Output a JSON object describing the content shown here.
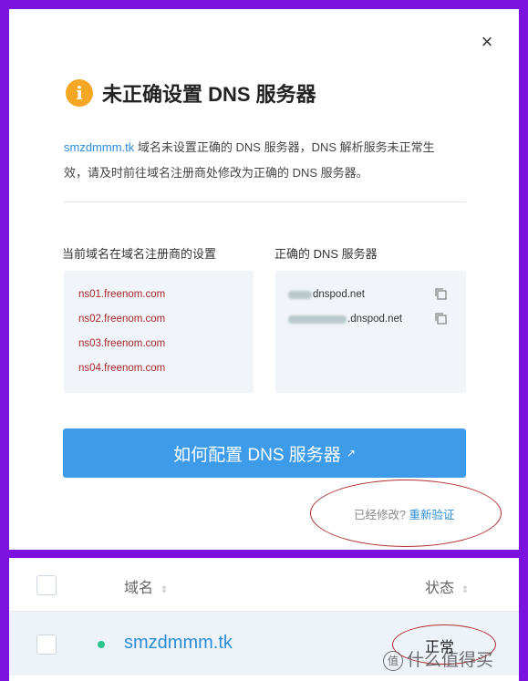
{
  "dialog": {
    "title": "未正确设置 DNS 服务器",
    "info_icon": "i",
    "close_label": "×",
    "desc_domain": "smzdmmm.tk",
    "desc_line1_rest": " 域名未设置正确的 DNS 服务器，DNS 解析服务未正常生",
    "desc_line2": "效，请及时前往域名注册商处修改为正确的 DNS 服务器。",
    "current_label": "当前域名在域名注册商的设置",
    "correct_label": "正确的 DNS 服务器",
    "current_ns": [
      "ns01.freenom.com",
      "ns02.freenom.com",
      "ns03.freenom.com",
      "ns04.freenom.com"
    ],
    "correct_ns": [
      "dnspod.net",
      ".dnspod.net"
    ],
    "config_button": "如何配置 DNS 服务器",
    "config_arrow": "↗",
    "modified_q": "已经修改? ",
    "reverify": "重新验证"
  },
  "table": {
    "col_domain": "域名",
    "col_status": "状态",
    "sort_icon": "⇕",
    "row": {
      "domain": "smzdmmm.tk",
      "status": "正常"
    }
  },
  "watermark": {
    "icon": "值",
    "text": "什么值得买"
  },
  "icons": [
    "close-icon",
    "info-icon",
    "copy-icon",
    "external-link-icon",
    "sort-icon",
    "status-dot-icon"
  ],
  "colors": {
    "accent": "#3d9be9",
    "link": "#2a8cd8",
    "error_text": "#a52828",
    "status_ok": "#2bc48c",
    "frame": "#7b12e0",
    "annotation": "#b03030"
  }
}
